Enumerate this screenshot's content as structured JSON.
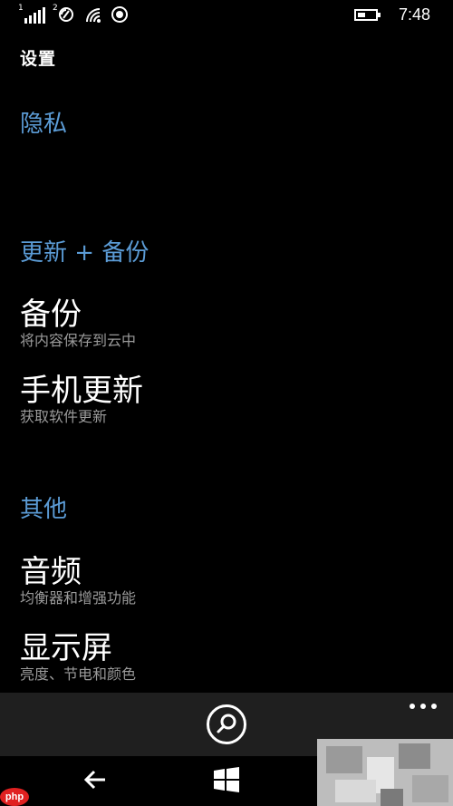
{
  "status_bar": {
    "sim1_label": "1",
    "sim2_label": "2",
    "time": "7:48",
    "battery_level_percent": 45,
    "icons": [
      "signal-bars-icon",
      "sim2-icon",
      "wifi-icon",
      "location-icon",
      "battery-icon"
    ]
  },
  "header": {
    "title": "设置"
  },
  "sections": [
    {
      "header": "隐私"
    },
    {
      "header": "更新 + 备份"
    },
    {
      "header": "其他"
    }
  ],
  "items": [
    {
      "title": "备份",
      "subtitle": "将内容保存到云中"
    },
    {
      "title": "手机更新",
      "subtitle": "获取软件更新"
    },
    {
      "title": "音频",
      "subtitle": "均衡器和增强功能"
    },
    {
      "title": "显示屏",
      "subtitle": "亮度、节电和颜色"
    }
  ],
  "app_bar": {
    "search_icon": "search-icon",
    "more_icon": "more-options-icon"
  },
  "nav_bar": {
    "back_icon": "back-arrow-icon",
    "start_icon": "windows-start-icon"
  },
  "watermark": {
    "text": "php"
  },
  "colors": {
    "accent": "#5b9bd5",
    "background": "#000000",
    "subtitle": "#9a9a9a",
    "app_bar": "#1f1f1f"
  }
}
